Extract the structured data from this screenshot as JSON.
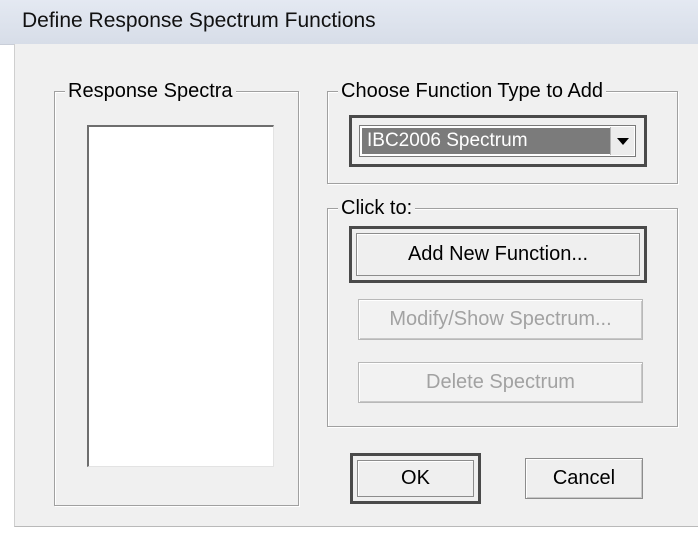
{
  "window": {
    "title": "Define Response Spectrum Functions"
  },
  "response_spectra": {
    "legend": "Response Spectra",
    "items": []
  },
  "function_type": {
    "legend": "Choose  Function Type to Add",
    "selected": "IBC2006 Spectrum"
  },
  "click_to": {
    "legend": "Click to:",
    "add_label": "Add New Function...",
    "modify_label": "Modify/Show Spectrum...",
    "delete_label": "Delete Spectrum"
  },
  "footer": {
    "ok_label": "OK",
    "cancel_label": "Cancel"
  }
}
